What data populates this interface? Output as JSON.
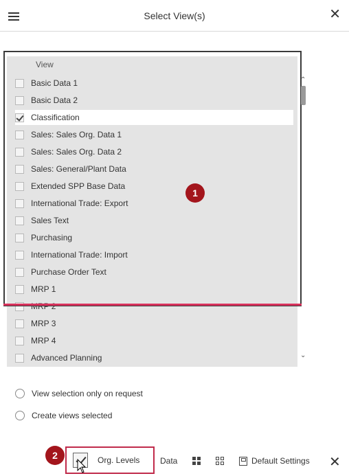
{
  "header": {
    "title": "Select View(s)"
  },
  "list": {
    "column_header": "View",
    "items": [
      {
        "label": "Basic Data 1",
        "checked": false
      },
      {
        "label": "Basic Data 2",
        "checked": false
      },
      {
        "label": "Classification",
        "checked": true
      },
      {
        "label": "Sales: Sales Org. Data 1",
        "checked": false
      },
      {
        "label": "Sales: Sales Org. Data 2",
        "checked": false
      },
      {
        "label": "Sales: General/Plant Data",
        "checked": false
      },
      {
        "label": "Extended SPP Base Data",
        "checked": false
      },
      {
        "label": "International Trade: Export",
        "checked": false
      },
      {
        "label": "Sales Text",
        "checked": false
      },
      {
        "label": "Purchasing",
        "checked": false
      },
      {
        "label": "International Trade: Import",
        "checked": false
      },
      {
        "label": "Purchase Order Text",
        "checked": false
      },
      {
        "label": "MRP 1",
        "checked": false
      },
      {
        "label": "MRP 2",
        "checked": false
      },
      {
        "label": "MRP 3",
        "checked": false
      },
      {
        "label": "MRP 4",
        "checked": false
      },
      {
        "label": "Advanced Planning",
        "checked": false
      }
    ]
  },
  "badges": {
    "one": "1",
    "two": "2"
  },
  "options": {
    "view_on_request": "View selection only on request",
    "create_views": "Create views selected"
  },
  "footer": {
    "org_levels": "Org. Levels",
    "data": "Data",
    "default_settings": "Default Settings"
  },
  "colors": {
    "badge": "#a3151c",
    "highlight_frame": "#c02a4a",
    "list_bg": "#e4e4e4"
  }
}
